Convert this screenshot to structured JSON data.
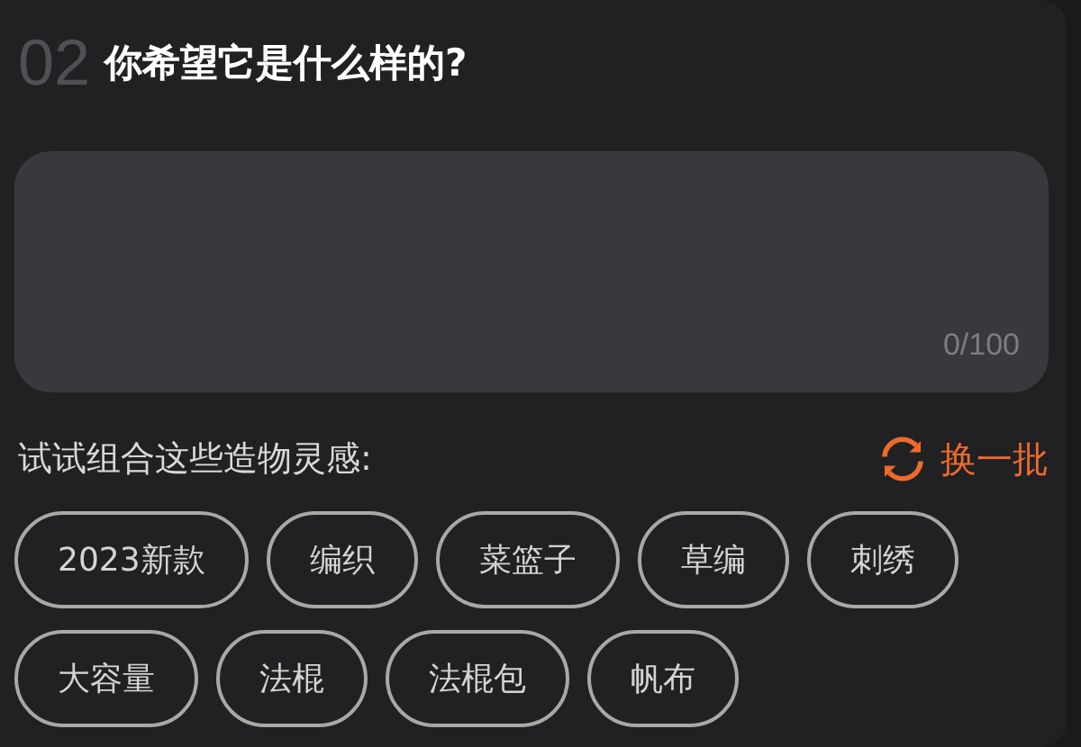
{
  "question": {
    "number": "02",
    "title": "你希望它是什么样的?"
  },
  "answer": {
    "counter": "0/100"
  },
  "suggestions": {
    "hint": "试试组合这些造物灵感:",
    "refresh_label": "换一批",
    "tags": [
      "2023新款",
      "编织",
      "菜篮子",
      "草编",
      "刺绣",
      "大容量",
      "法棍",
      "法棍包",
      "帆布"
    ]
  }
}
